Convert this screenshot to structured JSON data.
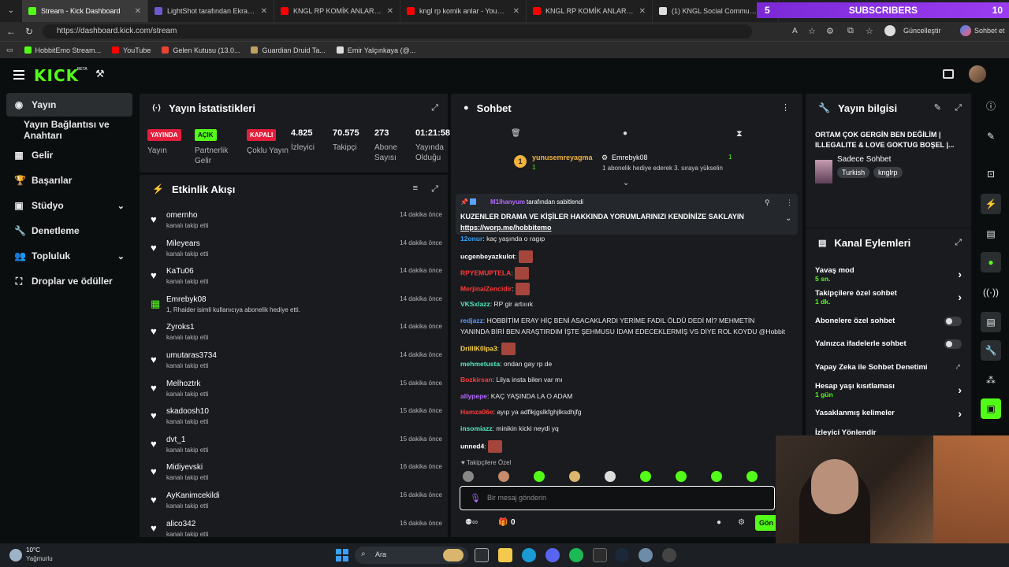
{
  "browser": {
    "tabs": [
      {
        "title": "Stream - Kick Dashboard",
        "color": "#53fc18",
        "active": true
      },
      {
        "title": "LightShot tarafından Ekran Görün",
        "color": "#6a5acd",
        "active": false
      },
      {
        "title": "KNGL RP KOMİK ANLAR #13 - You",
        "color": "#ff0000",
        "active": false
      },
      {
        "title": "kngl rp komik anlar - YouTube",
        "color": "#ff0000",
        "active": false
      },
      {
        "title": "KNGL RP KOMİK ANLAR PART #2",
        "color": "#ff0000",
        "active": false
      },
      {
        "title": "(1) KNGL Social Community / X",
        "color": "#dddddd",
        "active": false
      }
    ],
    "subscriber_count": "5",
    "subscriber_label": "SUBSCRIBERS",
    "subscriber_right": "10",
    "url": "https://dashboard.kick.com/stream",
    "update_label": "Güncelleştir",
    "chat_button": "Sohbet et",
    "bookmarks": [
      {
        "label": "HobbitEmo Stream...",
        "color": "#53fc18"
      },
      {
        "label": "YouTube",
        "color": "#ff0000"
      },
      {
        "label": "Gelen Kutusu (13.0...",
        "color": "#ea4335"
      },
      {
        "label": "Guardian Druid Ta...",
        "color": "#c0a060"
      },
      {
        "label": "Emir Yalçınkaya (@...",
        "color": "#dddddd"
      }
    ]
  },
  "kick": {
    "logo": "KICK",
    "logo_beta": "BETA"
  },
  "nav": [
    {
      "label": "Yayın",
      "icon": "broadcast-icon",
      "active": true
    },
    {
      "label": "Yayın Bağlantısı ve Anahtarı",
      "icon": "",
      "active": false
    },
    {
      "label": "Gelir",
      "icon": "money-icon",
      "active": false
    },
    {
      "label": "Başarılar",
      "icon": "trophy-icon",
      "active": false
    },
    {
      "label": "Stüdyo",
      "icon": "studio-icon",
      "active": false,
      "chevron": true
    },
    {
      "label": "Denetleme",
      "icon": "wrench-icon",
      "active": false
    },
    {
      "label": "Topluluk",
      "icon": "people-icon",
      "active": false,
      "chevron": true
    },
    {
      "label": "Droplar ve ödüller",
      "icon": "gift-icon",
      "active": false
    }
  ],
  "stats": {
    "title": "Yayın İstatistikleri",
    "items": [
      {
        "badge": "YAYINDA",
        "badge_color": "#e31e3c",
        "label": "Yayın"
      },
      {
        "badge": "AÇIK",
        "badge_color": "#53fc18",
        "label": "Partnerlik Gelir"
      },
      {
        "badge": "KAPALI",
        "badge_color": "#e31e3c",
        "label": "Çoklu Yayın"
      },
      {
        "value": "4.825",
        "label": "İzleyici"
      },
      {
        "value": "70.575",
        "label": "Takipçi"
      },
      {
        "value": "273",
        "label": "Abone Sayısı"
      },
      {
        "value": "01:21:58",
        "label": "Yayında Olduğu Süre"
      }
    ]
  },
  "activity": {
    "title": "Etkinlik Akışı",
    "rows": [
      {
        "name": "omernho",
        "sub": "kanalı takip etti",
        "time": "14 dakika önce",
        "kind": "follow"
      },
      {
        "name": "Mileyears",
        "sub": "kanalı takip etti",
        "time": "14 dakika önce",
        "kind": "follow"
      },
      {
        "name": "KaTu06",
        "sub": "kanalı takip etti",
        "time": "14 dakika önce",
        "kind": "follow"
      },
      {
        "name": "Emrebyk08",
        "sub": "1, Rhaider isimli kullanıcıya abonelik hediye etti.",
        "time": "14 dakika önce",
        "kind": "gift"
      },
      {
        "name": "Zyroks1",
        "sub": "kanalı takip etti",
        "time": "14 dakika önce",
        "kind": "follow"
      },
      {
        "name": "umutaras3734",
        "sub": "kanalı takip etti",
        "time": "14 dakika önce",
        "kind": "follow"
      },
      {
        "name": "Melhoztrk",
        "sub": "kanalı takip etti",
        "time": "15 dakika önce",
        "kind": "follow"
      },
      {
        "name": "skadoosh10",
        "sub": "kanalı takip etti",
        "time": "15 dakika önce",
        "kind": "follow"
      },
      {
        "name": "dvt_1",
        "sub": "kanalı takip etti",
        "time": "15 dakika önce",
        "kind": "follow"
      },
      {
        "name": "Midiyevski",
        "sub": "kanalı takip etti",
        "time": "16 dakika önce",
        "kind": "follow"
      },
      {
        "name": "AyKanimcekildi",
        "sub": "kanalı takip etti",
        "time": "16 dakika önce",
        "kind": "follow"
      },
      {
        "name": "alico342",
        "sub": "kanalı takip etti",
        "time": "16 dakika önce",
        "kind": "follow"
      }
    ]
  },
  "chat": {
    "title": "Sohbet",
    "leader1": "yunusemreyagma",
    "leader1_count": "1",
    "leader2": "Emrebyk08",
    "leader2_count": "1",
    "leader2_note": "1 abonelik hediye ederek 3. sıraya yükselin",
    "pinned_by": "M1lhanyum",
    "pinned_suffix": "tarafından sabitlendi",
    "pinned_text": "KUZENLER DRAMA VE KİŞİLER HAKKINDA YORUMLARINIZI KENDİNİZE SAKLAYIN",
    "pinned_link": "https://worp.me/hobbitemo",
    "messages": [
      {
        "user": "12onur",
        "color": "#2fa4ff",
        "text": "kaç yaşında o ragıp",
        "emote": false
      },
      {
        "user": "ucgenbeyazkulot",
        "color": "#ffffff",
        "text": "",
        "emote": true
      },
      {
        "user": "RPYEMUPTELA",
        "color": "#ff3b3b",
        "text": "",
        "emote": true
      },
      {
        "user": "MerjinaiZencidir",
        "color": "#ff3b3b",
        "text": "",
        "emote": true
      },
      {
        "user": "VKSxlazz",
        "color": "#54e8c0",
        "text": "RP gir artıııık",
        "emote": false
      },
      {
        "user": "redjazz",
        "color": "#5b9bff",
        "text": "HOBBİTİM ERAY HİÇ BENİ ASACAKLARDI YERİME FADIL ÖLDÜ DEDİ Mİ? MEHMETİN",
        "emote": false
      },
      {
        "user": "",
        "color": "#ffffff",
        "text": "YANINDA BİRİ BEN ARAŞTIRDIM İŞTE ŞEHMUSU İDAM EDECEKLERMİŞ VS DİYE ROL KOYDU @Hobbit",
        "emote": false
      },
      {
        "user": "DrillIK0lpa3",
        "color": "#ffd54a",
        "text": "",
        "emote": true
      },
      {
        "user": "mehmetusta",
        "color": "#54e8c0",
        "text": "ondan gay rp de",
        "emote": false
      },
      {
        "user": "Bozkirsan",
        "color": "#ff3b3b",
        "text": "Lilya insta bilen var mı",
        "emote": false
      },
      {
        "user": "allypepe",
        "color": "#b36bff",
        "text": "KAÇ YAŞINDA LA O ADAM",
        "emote": false
      },
      {
        "user": "Hamza06e",
        "color": "#ff3b3b",
        "text": "ayıp ya adflkjgslkfghjlksdhjfg",
        "emote": false
      },
      {
        "user": "insomiazz",
        "color": "#54e8c0",
        "text": "minikin kicki neydi yq",
        "emote": false
      },
      {
        "user": "unned4",
        "color": "#ffffff",
        "text": "",
        "emote": true
      }
    ],
    "followers_only": "Takipçilere Özel",
    "input_placeholder": "Bir mesaj gönderin",
    "points": "0",
    "send_label": "Gön"
  },
  "stream_info": {
    "title": "Yayın bilgisi",
    "stream_title": "ORTAM ÇOK GERGİN BEN DEĞİLİM | ILLEGALITE & LOVE GOKTUG BOŞEL |...",
    "category": "Sadece Sohbet",
    "tags": [
      "Turkish",
      "knglrp"
    ]
  },
  "channel_actions": {
    "title": "Kanal Eylemleri",
    "items": [
      {
        "label": "Yavaş mod",
        "value": "5 sn.",
        "control": "chevron"
      },
      {
        "label": "Takipçilere özel sohbet",
        "value": "1 dk.",
        "control": "chevron"
      },
      {
        "label": "Abonelere özel sohbet",
        "value": "",
        "control": "toggle"
      },
      {
        "label": "Yalnızca ifadelerle sohbet",
        "value": "",
        "control": "toggle"
      },
      {
        "label": "Yapay Zeka ile Sohbet Denetimi",
        "value": "",
        "control": "external"
      },
      {
        "label": "Hesap yaşı kısıtlaması",
        "value": "1 gün",
        "control": "chevron"
      },
      {
        "label": "Yasaklanmış kelimeler",
        "value": "",
        "control": "chevron"
      },
      {
        "label": "İzleyici Yönlendir",
        "value": "",
        "control": "none"
      }
    ]
  },
  "taskbar": {
    "weather_temp": "10°C",
    "weather_text": "Yağmurlu",
    "search": "Ara"
  },
  "colors": {
    "kick_green": "#53fc18",
    "panel_bg": "#191b1f",
    "page_bg": "#0b0e0f",
    "live_red": "#e31e3c"
  }
}
